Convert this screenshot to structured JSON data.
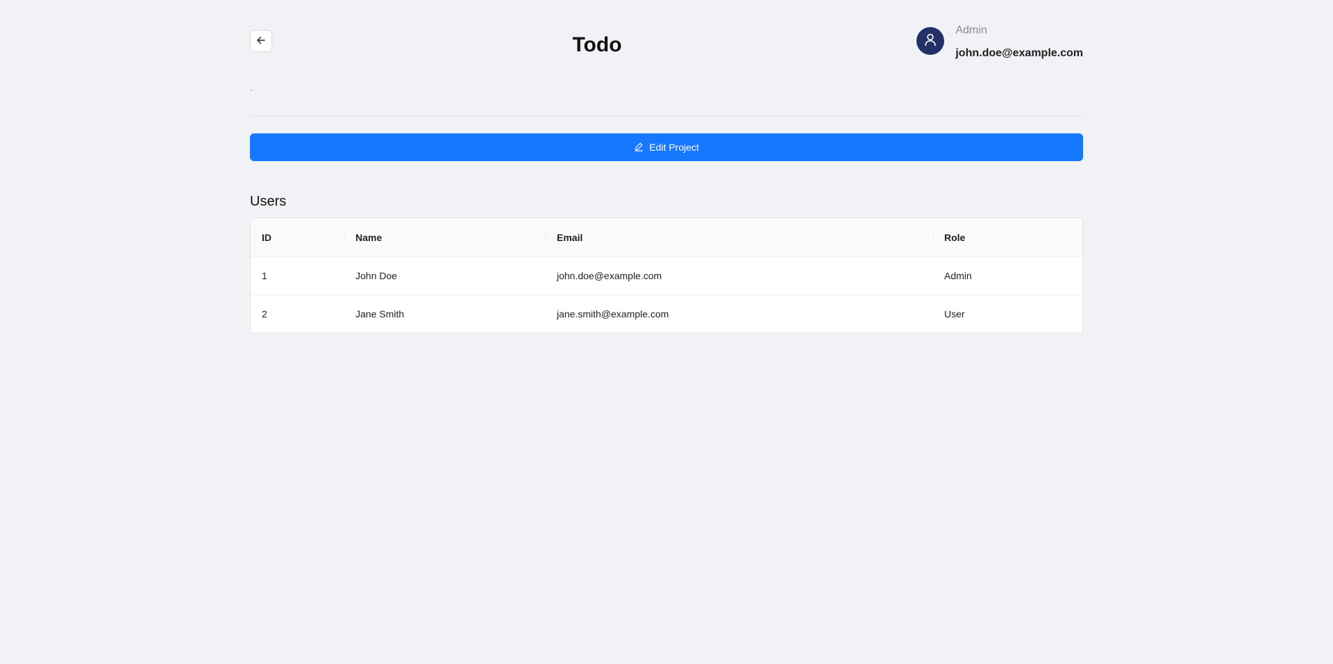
{
  "header": {
    "title": "Todo",
    "user": {
      "role": "Admin",
      "email": "john.doe@example.com"
    }
  },
  "project": {
    "description": "-",
    "edit_label": "Edit Project"
  },
  "users_section": {
    "title": "Users",
    "columns": [
      "ID",
      "Name",
      "Email",
      "Role"
    ],
    "rows": [
      {
        "id": "1",
        "name": "John Doe",
        "email": "john.doe@example.com",
        "role": "Admin"
      },
      {
        "id": "2",
        "name": "Jane Smith",
        "email": "jane.smith@example.com",
        "role": "User"
      }
    ]
  },
  "colors": {
    "background": "#f0f2f5",
    "primary": "#1677ff",
    "avatar": "#233168"
  },
  "icons": {
    "back": "arrow-left-icon",
    "avatar": "user-icon",
    "edit": "edit-icon"
  }
}
